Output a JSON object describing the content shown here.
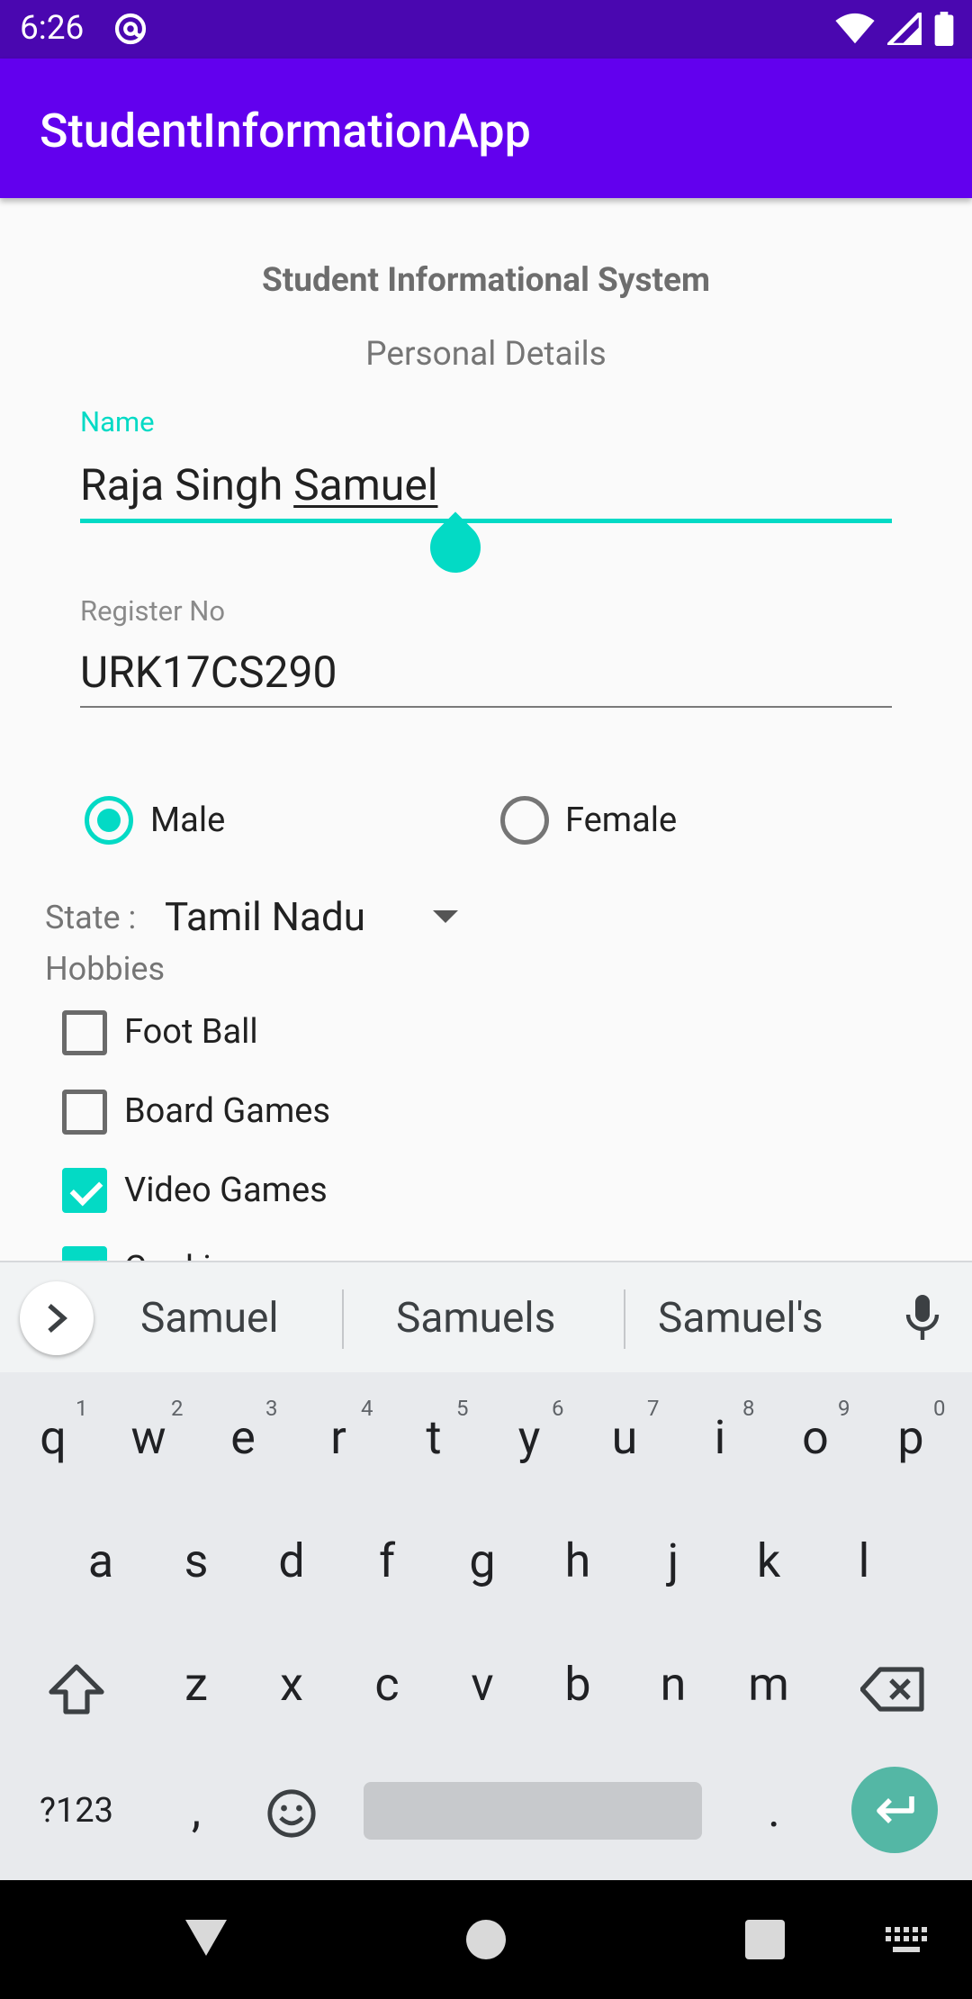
{
  "status_bar": {
    "time": "6:26"
  },
  "app_bar": {
    "title": "StudentInformationApp"
  },
  "form": {
    "heading": "Student Informational System",
    "subheading": "Personal Details",
    "name_field": {
      "label": "Name",
      "value_plain": "Raja Singh ",
      "value_composing": "Samuel"
    },
    "register_field": {
      "label": "Register No",
      "value": "URK17CS290"
    },
    "gender": {
      "male_label": "Male",
      "female_label": "Female",
      "selected": "Male"
    },
    "state": {
      "label": "State :",
      "value": "Tamil Nadu"
    },
    "hobbies": {
      "label": "Hobbies",
      "items": [
        {
          "label": "Foot Ball",
          "checked": false
        },
        {
          "label": "Board Games",
          "checked": false
        },
        {
          "label": "Video Games",
          "checked": true
        },
        {
          "label": "Cooking",
          "checked": true
        }
      ]
    }
  },
  "keyboard": {
    "suggestions": [
      "Samuel",
      "Samuels",
      "Samuel's"
    ],
    "row1": [
      "q",
      "w",
      "e",
      "r",
      "t",
      "y",
      "u",
      "i",
      "o",
      "p"
    ],
    "row1_hints": [
      "1",
      "2",
      "3",
      "4",
      "5",
      "6",
      "7",
      "8",
      "9",
      "0"
    ],
    "row2": [
      "a",
      "s",
      "d",
      "f",
      "g",
      "h",
      "j",
      "k",
      "l"
    ],
    "row3": [
      "z",
      "x",
      "c",
      "v",
      "b",
      "n",
      "m"
    ],
    "symbols_label": "?123",
    "comma": ",",
    "period": "."
  },
  "colors": {
    "accent": "#03dac5",
    "primary": "#6200ee",
    "primary_dark": "#4a07b0"
  }
}
